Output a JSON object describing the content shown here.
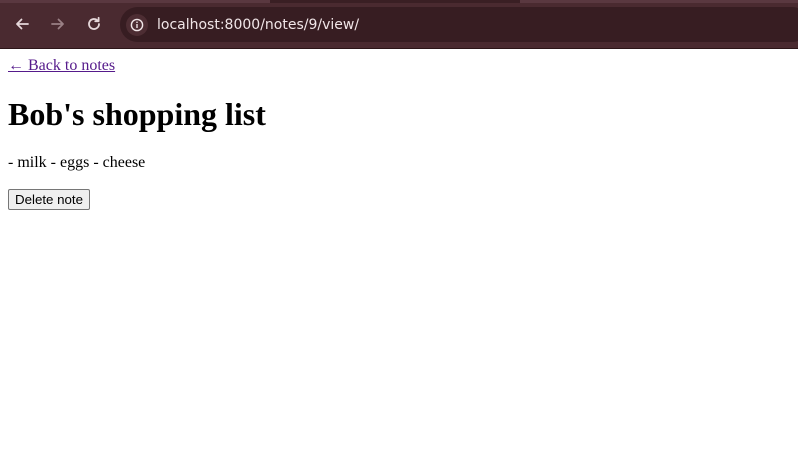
{
  "browser": {
    "url": "localhost:8000/notes/9/view/",
    "icons": {
      "back": "arrow-left-icon",
      "forward": "arrow-right-icon",
      "reload": "reload-icon",
      "site_info": "info-icon"
    },
    "colors": {
      "toolbar": "#4a2a30",
      "omnibox": "#371d22",
      "url_text": "#f1e6e8"
    }
  },
  "page": {
    "back_link": "← Back to notes",
    "title": "Bob's shopping list",
    "body": "- milk - eggs - cheese",
    "delete_button": "Delete note",
    "colors": {
      "link_visited": "#551a8b"
    }
  }
}
